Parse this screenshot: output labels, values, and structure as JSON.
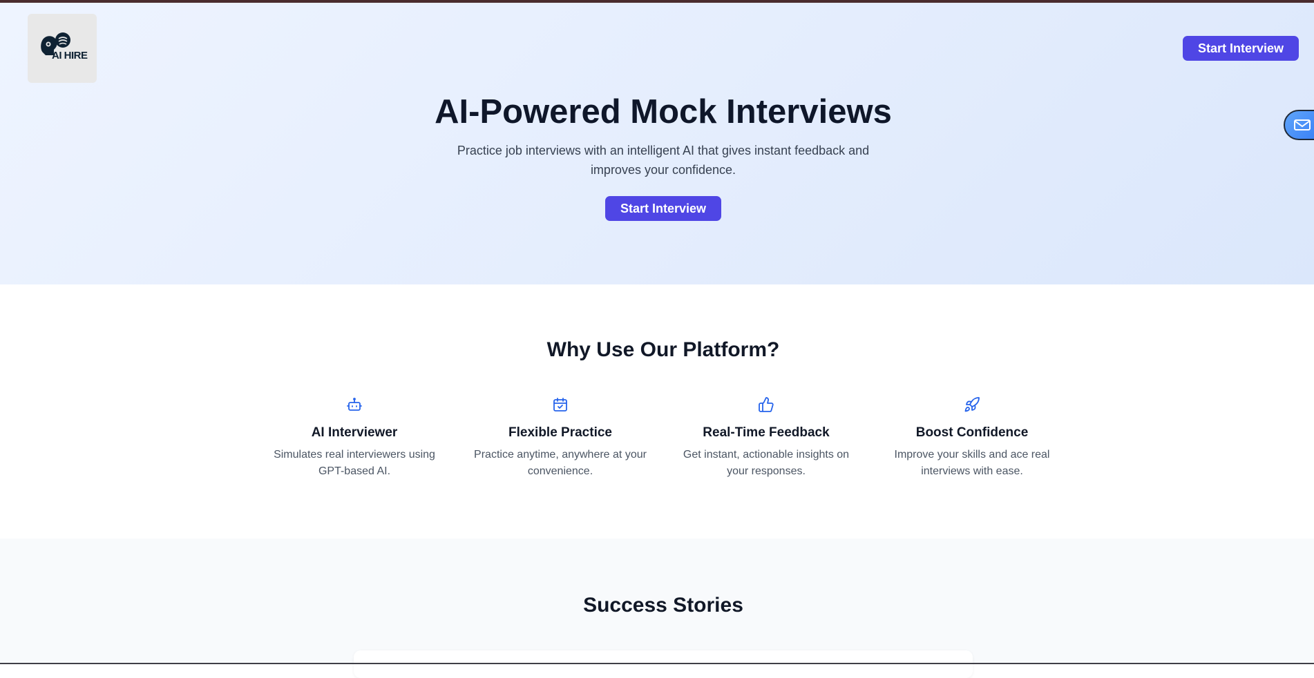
{
  "logo": {
    "text": "AI HIRE"
  },
  "nav": {
    "cta_label": "Start Interview"
  },
  "hero": {
    "title": "AI-Powered Mock Interviews",
    "subtitle": "Practice job interviews with an intelligent AI that gives instant feedback and improves your confidence.",
    "cta_label": "Start Interview"
  },
  "features": {
    "title": "Why Use Our Platform?",
    "items": [
      {
        "icon": "robot-icon",
        "title": "AI Interviewer",
        "description": "Simulates real interviewers using GPT-based AI."
      },
      {
        "icon": "calendar-check-icon",
        "title": "Flexible Practice",
        "description": "Practice anytime, anywhere at your convenience."
      },
      {
        "icon": "thumbs-up-icon",
        "title": "Real-Time Feedback",
        "description": "Get instant, actionable insights on your responses."
      },
      {
        "icon": "rocket-icon",
        "title": "Boost Confidence",
        "description": "Improve your skills and ace real interviews with ease."
      }
    ]
  },
  "stories": {
    "title": "Success Stories"
  },
  "colors": {
    "primary": "#4f46e5",
    "icon_accent": "#2563eb",
    "heading": "#0f172a",
    "hero_bg": "#e4edfd"
  }
}
